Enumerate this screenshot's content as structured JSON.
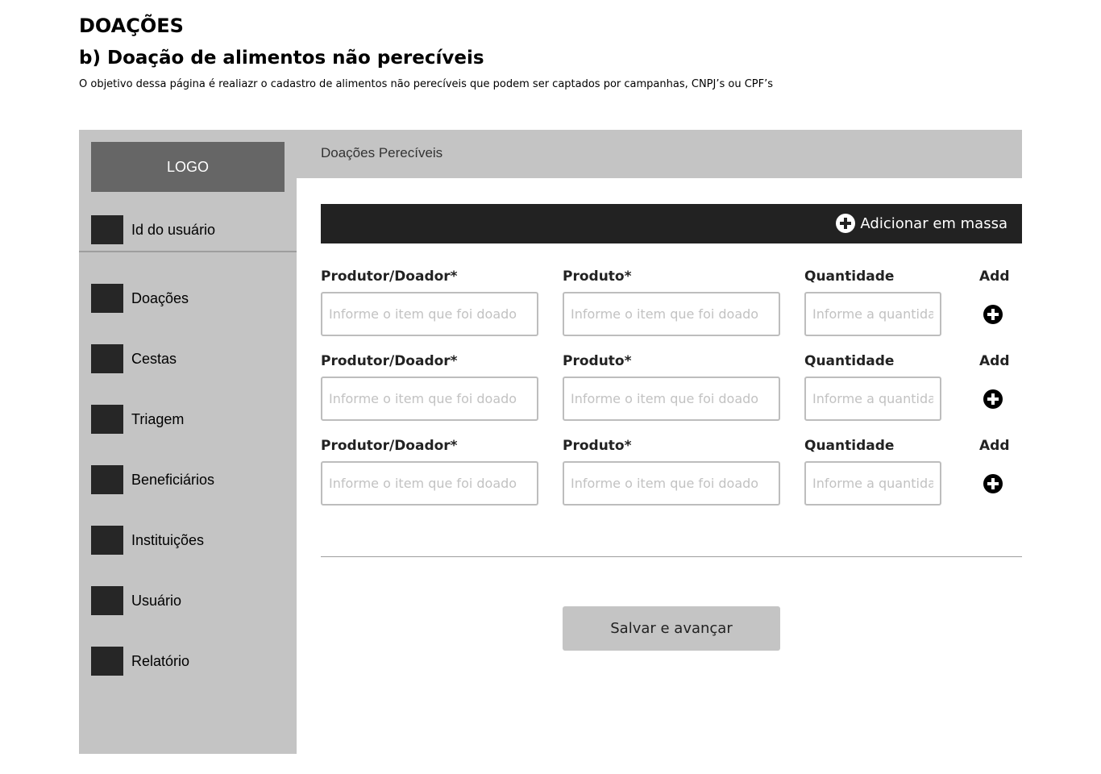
{
  "header": {
    "title": "DOAÇÕES",
    "subtitle": "b) Doação de alimentos não perecíveis",
    "description": "O objetivo dessa página é realiazr o cadastro de alimentos não perecíveis que podem ser captados por campanhas, CNPJ’s ou CPF’s"
  },
  "sidebar": {
    "logo": "LOGO",
    "user_label": "Id do usuário",
    "items": [
      {
        "label": "Doações"
      },
      {
        "label": "Cestas"
      },
      {
        "label": "Triagem"
      },
      {
        "label": "Beneficiários"
      },
      {
        "label": "Instituições"
      },
      {
        "label": "Usuário"
      },
      {
        "label": "Relatório"
      }
    ]
  },
  "main": {
    "topbar_title": "Doações Perecíveis",
    "mass_add_label": "Adicionar em massa",
    "rows": [
      {
        "producer_label": "Produtor/Doador*",
        "producer_placeholder": "Informe o item que foi doado",
        "product_label": "Produto*",
        "product_placeholder": "Informe o item que foi doado",
        "quantity_label": "Quantidade",
        "quantity_placeholder": "Informe a quantidade",
        "add_label": "Add"
      },
      {
        "producer_label": "Produtor/Doador*",
        "producer_placeholder": "Informe o item que foi doado",
        "product_label": "Produto*",
        "product_placeholder": "Informe o item que foi doado",
        "quantity_label": "Quantidade",
        "quantity_placeholder": "Informe a quantidade",
        "add_label": "Add"
      },
      {
        "producer_label": "Produtor/Doador*",
        "producer_placeholder": "Informe o item que foi doado",
        "product_label": "Produto*",
        "product_placeholder": "Informe o item que foi doado",
        "quantity_label": "Quantidade",
        "quantity_placeholder": "Informe a quantidade",
        "add_label": "Add"
      }
    ],
    "save_label": "Salvar e avançar"
  },
  "icons": {
    "mass_add": "plus-circle-icon",
    "row_add": "plus-circle-icon",
    "nav": "square-icon"
  },
  "colors": {
    "sidebar_bg": "#c4c4c4",
    "logo_bg": "#666666",
    "nav_square": "#262626",
    "action_bar": "#222222",
    "button_bg": "#c4c4c4"
  }
}
